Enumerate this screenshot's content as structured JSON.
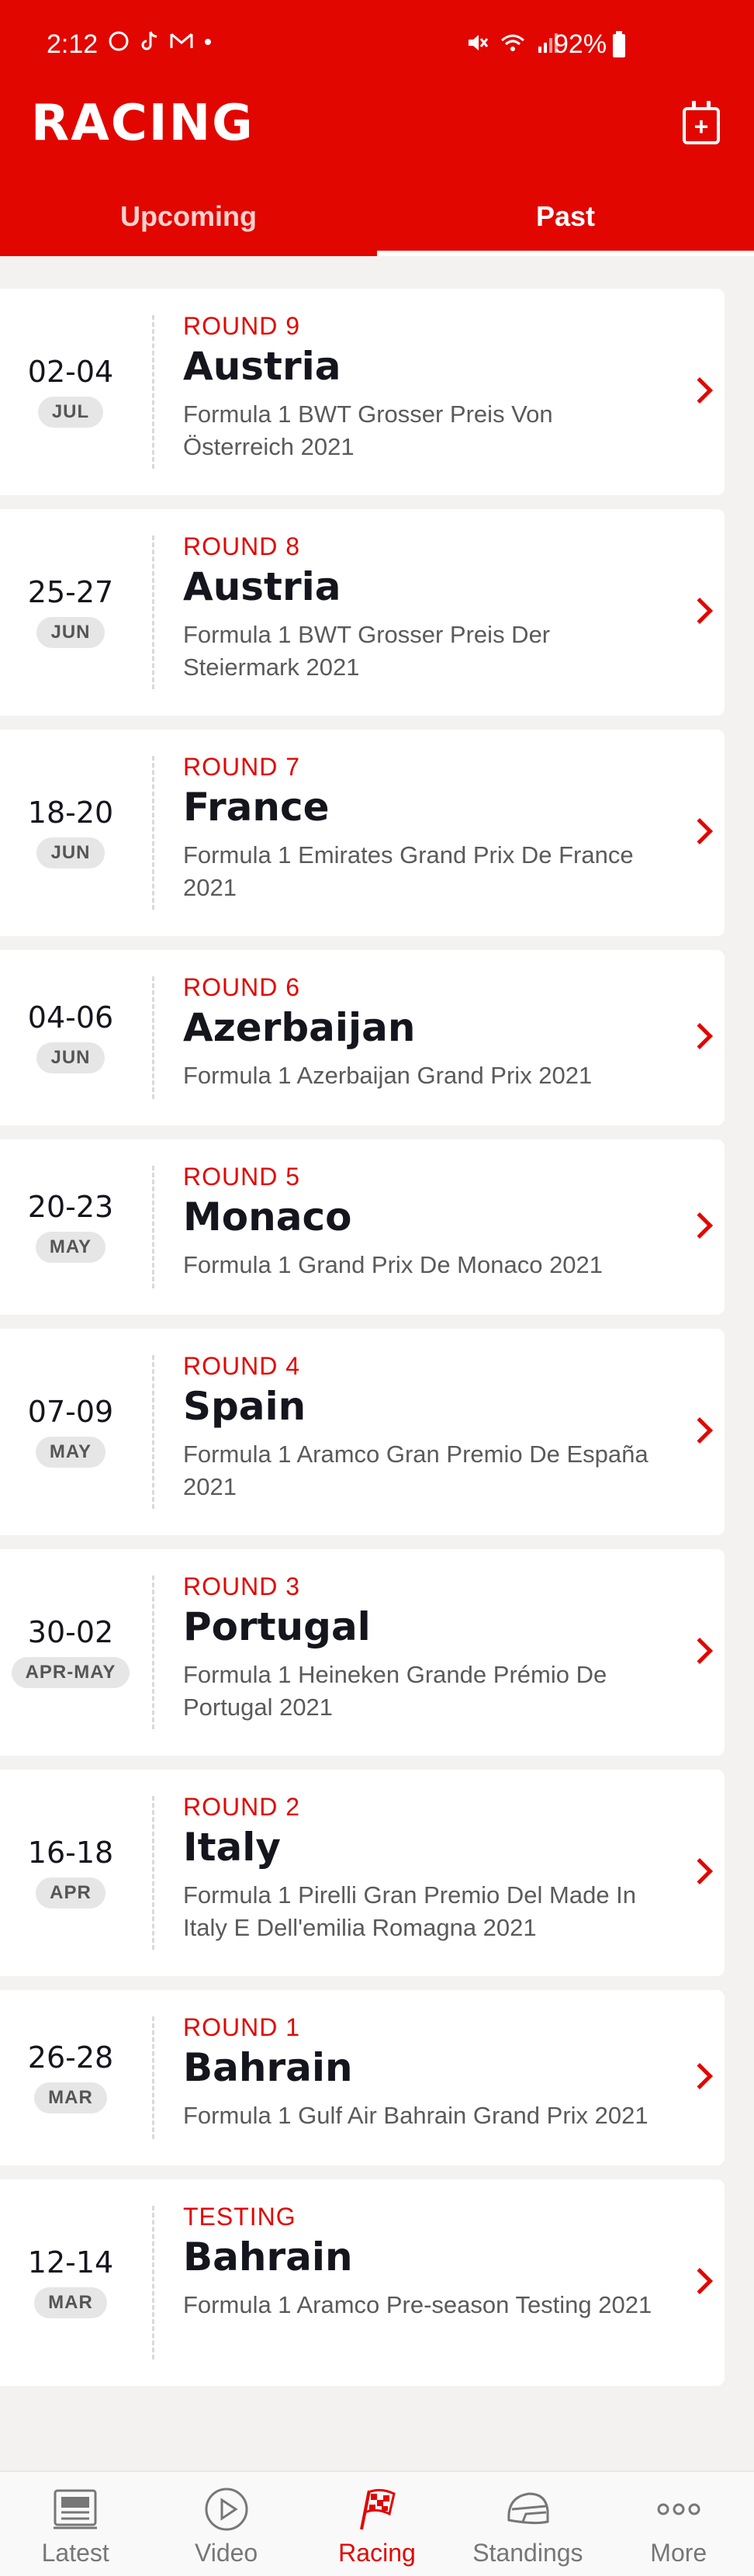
{
  "status_bar": {
    "time": "2:12",
    "battery": "92%"
  },
  "header": {
    "title": "RACING",
    "calendar_icon": "calendar-add-icon"
  },
  "tabs": [
    {
      "label": "Upcoming",
      "active": false
    },
    {
      "label": "Past",
      "active": true
    }
  ],
  "events": [
    {
      "dates": "02-04",
      "month": "JUL",
      "round": "ROUND 9",
      "country": "Austria",
      "name": "Formula 1 BWT Grosser Preis Von Österreich 2021"
    },
    {
      "dates": "25-27",
      "month": "JUN",
      "round": "ROUND 8",
      "country": "Austria",
      "name": "Formula 1 BWT Grosser Preis Der Steiermark 2021"
    },
    {
      "dates": "18-20",
      "month": "JUN",
      "round": "ROUND 7",
      "country": "France",
      "name": "Formula 1 Emirates Grand Prix De France 2021"
    },
    {
      "dates": "04-06",
      "month": "JUN",
      "round": "ROUND 6",
      "country": "Azerbaijan",
      "name": "Formula 1 Azerbaijan Grand Prix 2021"
    },
    {
      "dates": "20-23",
      "month": "MAY",
      "round": "ROUND 5",
      "country": "Monaco",
      "name": "Formula 1 Grand Prix De Monaco 2021"
    },
    {
      "dates": "07-09",
      "month": "MAY",
      "round": "ROUND 4",
      "country": "Spain",
      "name": "Formula 1 Aramco Gran Premio De España 2021"
    },
    {
      "dates": "30-02",
      "month": "APR-MAY",
      "round": "ROUND 3",
      "country": "Portugal",
      "name": "Formula 1 Heineken Grande Prémio De Portugal 2021"
    },
    {
      "dates": "16-18",
      "month": "APR",
      "round": "ROUND 2",
      "country": "Italy",
      "name": "Formula 1 Pirelli Gran Premio Del Made In Italy E Dell'emilia Romagna 2021"
    },
    {
      "dates": "26-28",
      "month": "MAR",
      "round": "ROUND 1",
      "country": "Bahrain",
      "name": "Formula 1 Gulf Air Bahrain Grand Prix 2021"
    },
    {
      "dates": "12-14",
      "month": "MAR",
      "round": "TESTING",
      "country": "Bahrain",
      "name": "Formula 1 Aramco Pre-season Testing 2021"
    }
  ],
  "bottom_nav": [
    {
      "label": "Latest",
      "icon": "news-icon",
      "active": false
    },
    {
      "label": "Video",
      "icon": "play-icon",
      "active": false
    },
    {
      "label": "Racing",
      "icon": "checkered-flag-icon",
      "active": true
    },
    {
      "label": "Standings",
      "icon": "helmet-icon",
      "active": false
    },
    {
      "label": "More",
      "icon": "more-icon",
      "active": false
    }
  ],
  "colors": {
    "brand_red": "#e10600",
    "text_dark": "#15151e",
    "background": "#f3f2f0"
  }
}
